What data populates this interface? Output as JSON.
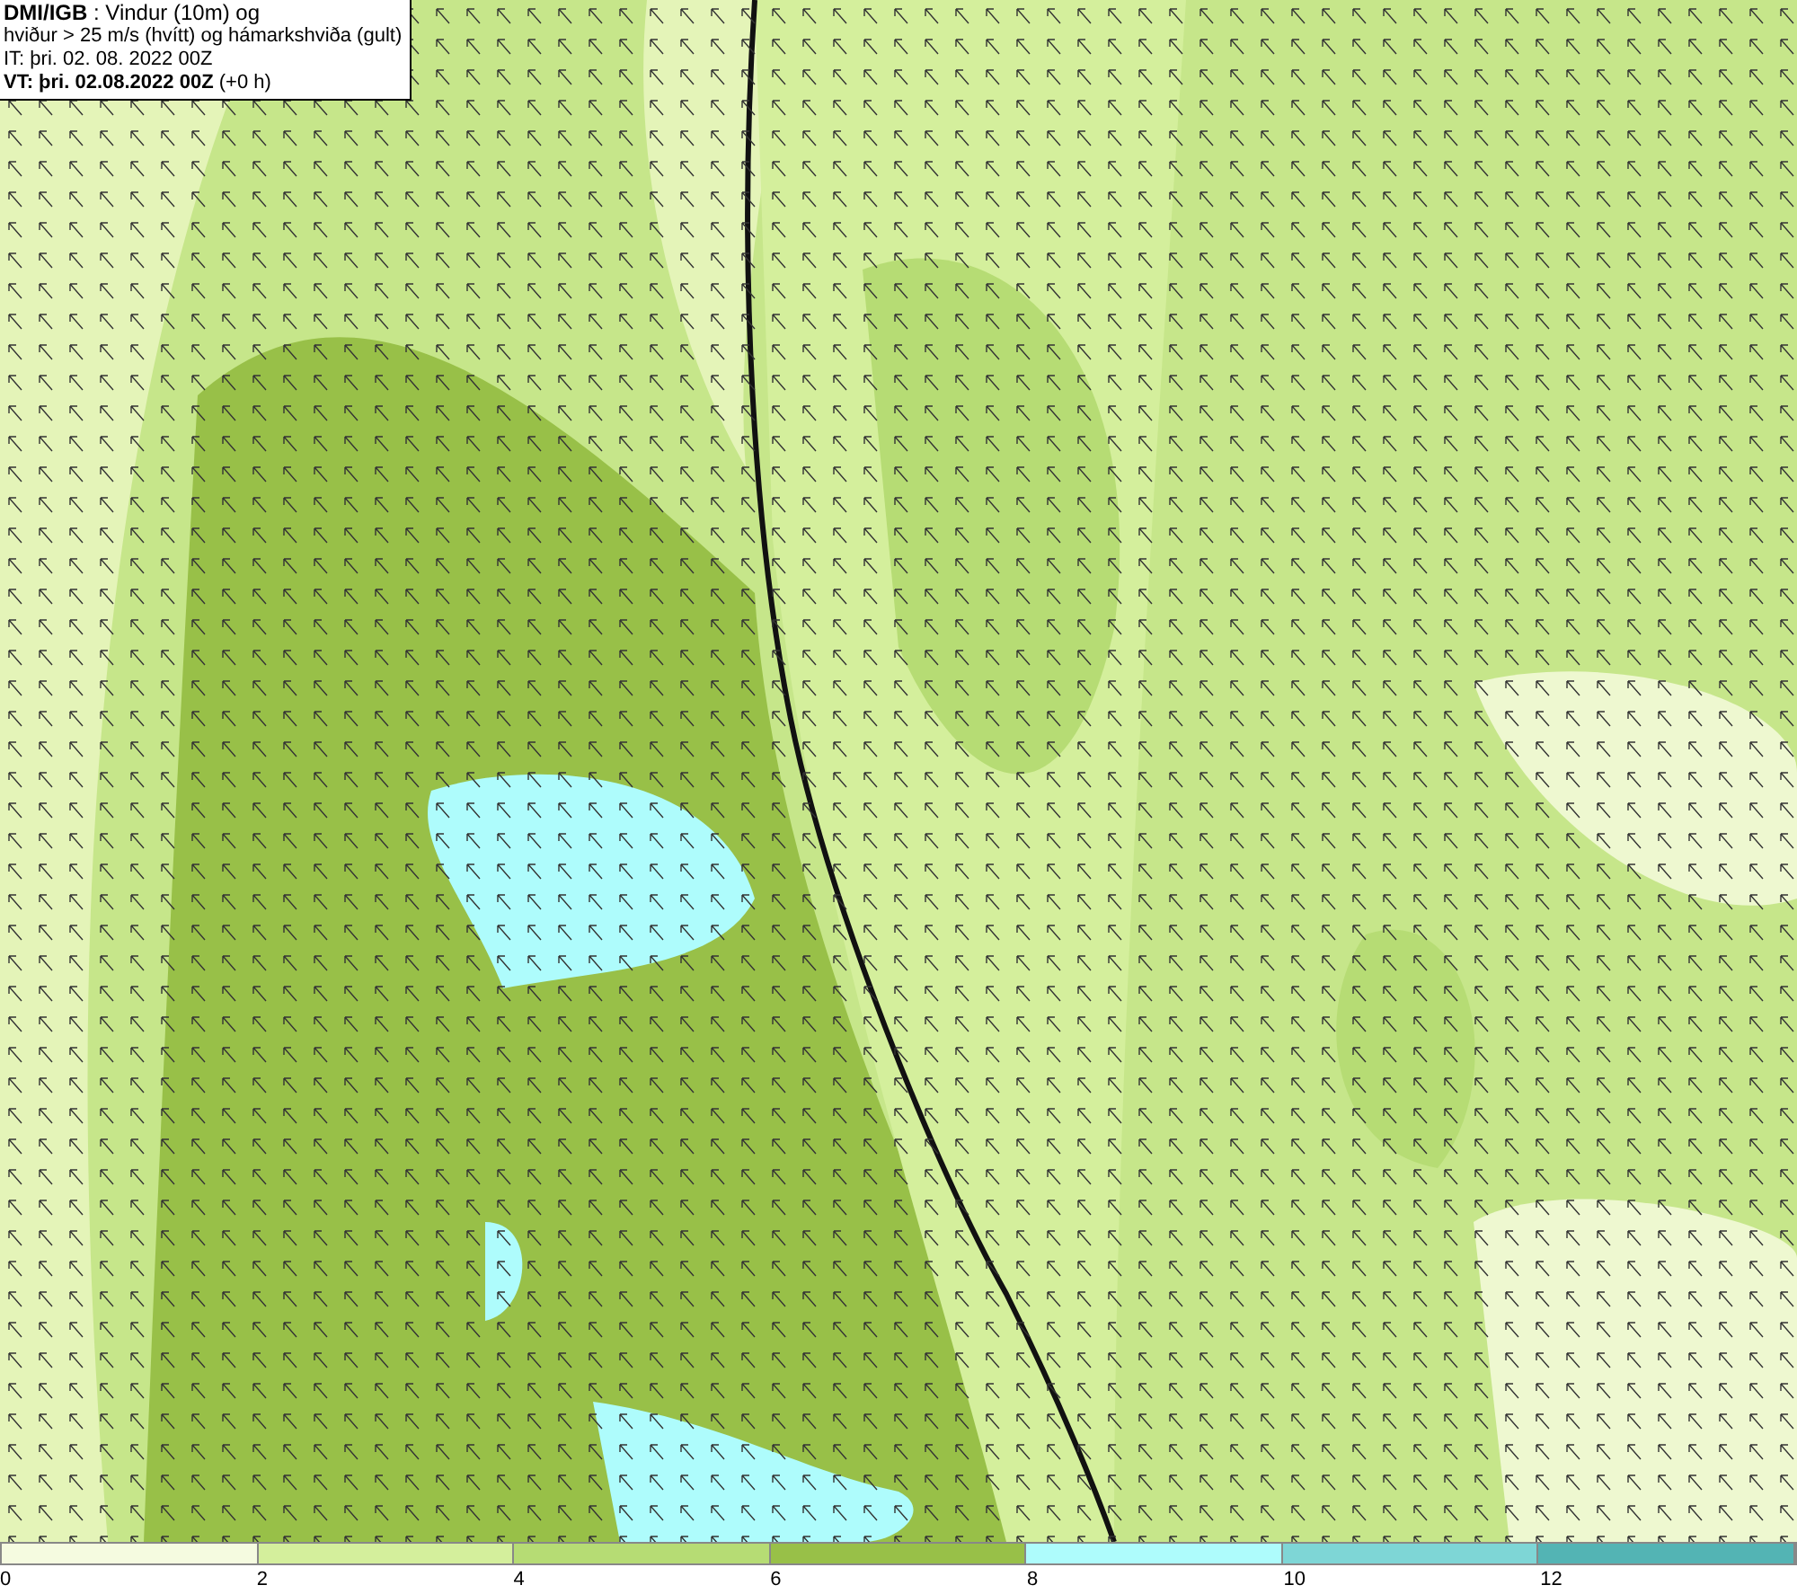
{
  "title_box": {
    "lines": [
      "**DMI/IGB** : Vindur (10m) og",
      "hviður > 25 m/s (hvítt) og hámarkshviða (gult)",
      "IT: þri. 02. 08. 2022 00Z",
      "**VT: þri. 02.08.2022 00Z** (+0 h)"
    ]
  },
  "legend": {
    "bins": [
      {
        "color": "#f5fbe0"
      },
      {
        "color": "#d4ef9c"
      },
      {
        "color": "#b6dc74"
      },
      {
        "color": "#98c048"
      },
      {
        "color": "#aefcfc"
      },
      {
        "color": "#7ed6d6"
      },
      {
        "color": "#53b4b4"
      }
    ],
    "labels": [
      "0",
      "2",
      "4",
      "6",
      "8",
      "10",
      "12"
    ]
  }
}
